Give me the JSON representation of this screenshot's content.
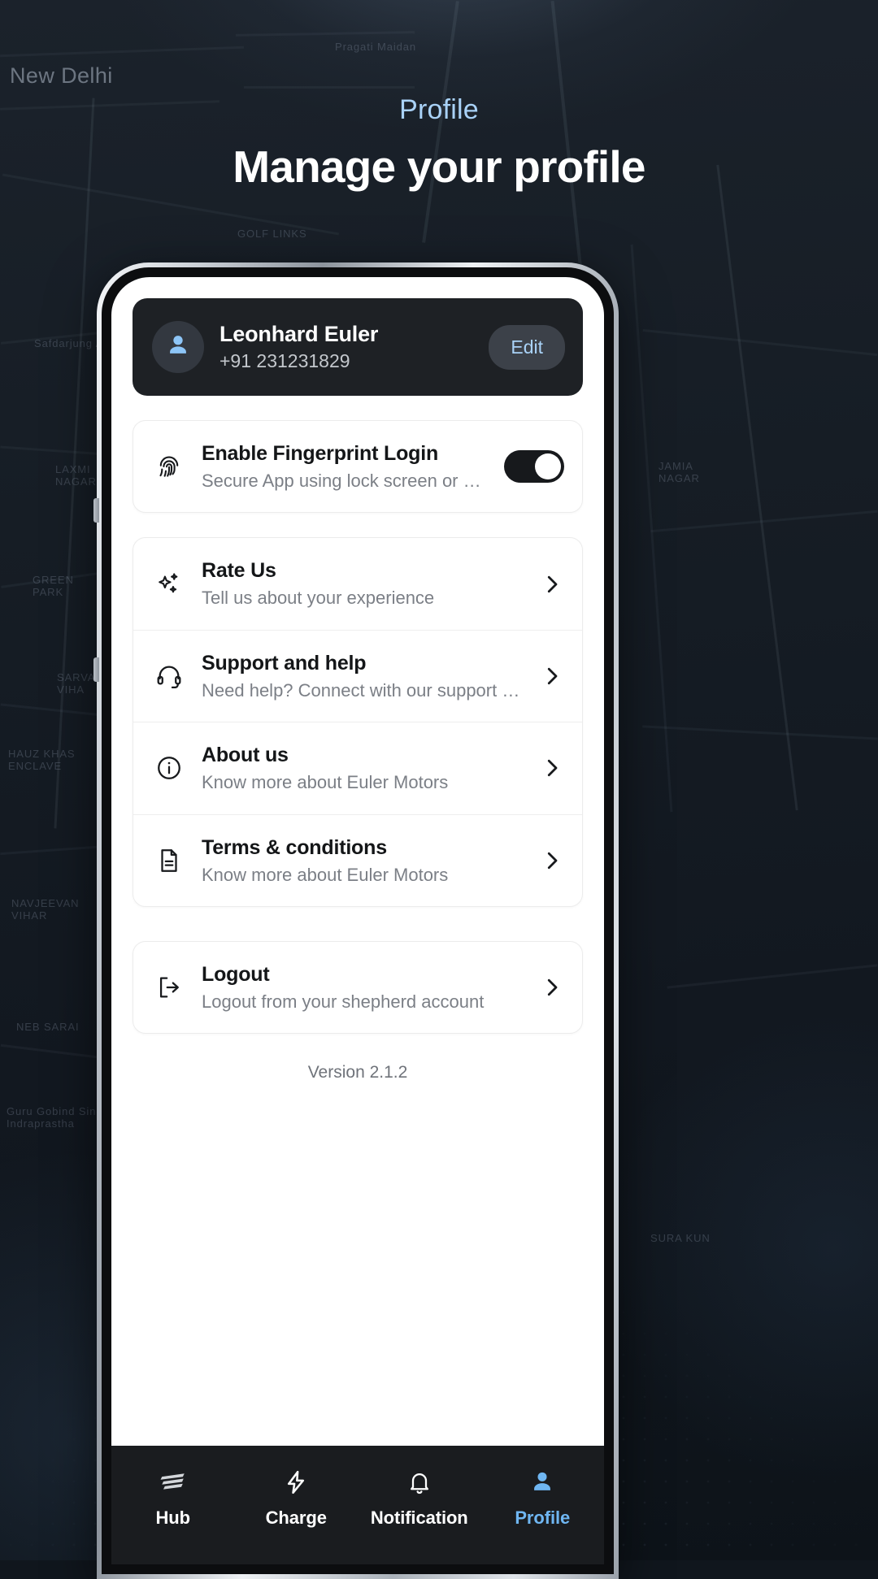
{
  "header": {
    "eyebrow": "Profile",
    "eyebrow_color": "#a9d2f7",
    "headline": "Manage your profile"
  },
  "map_labels": [
    {
      "text": "New Delhi",
      "size": "big"
    },
    {
      "text": "Pragati Maidan",
      "size": "small"
    },
    {
      "text": "GOLF LINKS",
      "size": "small"
    },
    {
      "text": "Safdarjung A",
      "size": "small"
    },
    {
      "text": "LAXMI\nNAGAR",
      "size": "small"
    },
    {
      "text": "JAMIA\nNAGAR",
      "size": "small"
    },
    {
      "text": "GREEN\nPARK",
      "size": "small"
    },
    {
      "text": "HAUZ KHAS\nENCLAVE",
      "size": "small"
    },
    {
      "text": "SARVAP\nVIHA",
      "size": "small"
    },
    {
      "text": "NAVJEEVAN\nVIHAR",
      "size": "small"
    },
    {
      "text": "NEB SARAI",
      "size": "small"
    },
    {
      "text": "SURA KUN",
      "size": "small"
    },
    {
      "text": "Guru Gobind Singh\nIndraprastha",
      "size": "small"
    }
  ],
  "profile": {
    "avatar_icon": "person-icon",
    "name": "Leonhard Euler",
    "phone": "+91 231231829",
    "edit_label": "Edit",
    "edit_text_color": "#a9d2f7",
    "card_bg": "#1e2125"
  },
  "fingerprint": {
    "icon": "fingerprint-icon",
    "title": "Enable Fingerprint Login",
    "subtitle": "Secure App using lock screen or PIN",
    "toggle_on": true,
    "toggle_state_label": "On"
  },
  "menu_items": [
    {
      "icon": "sparkle-icon",
      "title": "Rate Us",
      "subtitle": "Tell us about your experience"
    },
    {
      "icon": "headset-icon",
      "title": "Support and help",
      "subtitle": "Need help? Connect with our support t…"
    },
    {
      "icon": "info-circle-icon",
      "title": "About us",
      "subtitle": "Know more about Euler Motors"
    },
    {
      "icon": "document-icon",
      "title": "Terms & conditions",
      "subtitle": "Know more about Euler Motors"
    }
  ],
  "logout": {
    "icon": "logout-icon",
    "title": "Logout",
    "subtitle": "Logout from your shepherd account"
  },
  "version": "Version 2.1.2",
  "bottom_nav": {
    "active_color": "#6fb6f2",
    "items": [
      {
        "icon": "hub-icon",
        "label": "Hub",
        "active": false
      },
      {
        "icon": "bolt-icon",
        "label": "Charge",
        "active": false
      },
      {
        "icon": "bell-icon",
        "label": "Notification",
        "active": false
      },
      {
        "icon": "person-icon",
        "label": "Profile",
        "active": true
      }
    ]
  }
}
